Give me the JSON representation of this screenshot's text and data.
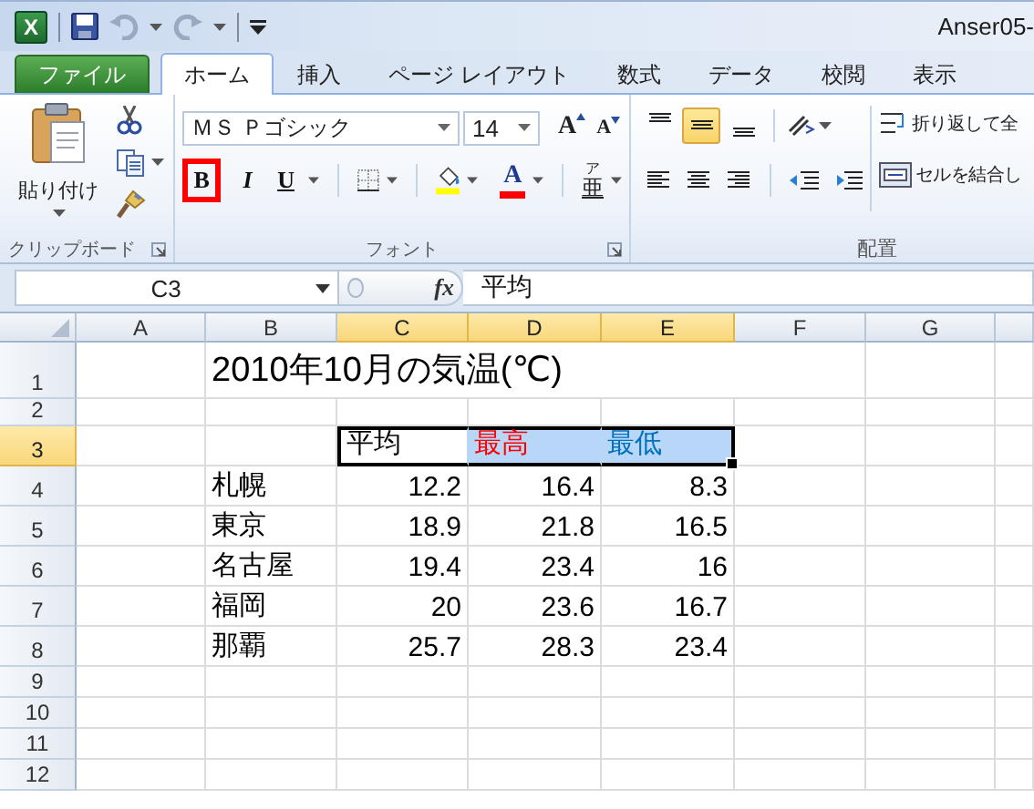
{
  "window": {
    "logo": "X",
    "title": "Anser05-"
  },
  "tabs": [
    {
      "label": "ファイル",
      "kind": "file",
      "selected": false
    },
    {
      "label": "ホーム",
      "kind": "normal",
      "selected": true
    },
    {
      "label": "挿入",
      "kind": "normal",
      "selected": false
    },
    {
      "label": "ページ レイアウト",
      "kind": "normal",
      "selected": false
    },
    {
      "label": "数式",
      "kind": "normal",
      "selected": false
    },
    {
      "label": "データ",
      "kind": "normal",
      "selected": false
    },
    {
      "label": "校閲",
      "kind": "normal",
      "selected": false
    },
    {
      "label": "表示",
      "kind": "normal",
      "selected": false
    }
  ],
  "clipboard": {
    "paste": "貼り付け",
    "label": "クリップボード"
  },
  "font": {
    "font_name": "ＭＳ Ｐゴシック",
    "font_size": "14",
    "grow": "A",
    "shrink": "A",
    "bold": {
      "label": "B",
      "highlighted": true
    },
    "italic": "I",
    "underline": "U",
    "font_color": "A",
    "phonetic": {
      "ruby": "ア",
      "base": "亜"
    },
    "label": "フォント"
  },
  "alignment": {
    "vertical": [
      {
        "kind": "top",
        "selected": false
      },
      {
        "kind": "middle",
        "selected": true
      },
      {
        "kind": "bottom",
        "selected": false
      }
    ],
    "wrap_text": "折り返して全",
    "merge": "セルを結合し",
    "label": "配置"
  },
  "formula_bar": {
    "name_box": "C3",
    "function_button": "fx",
    "formula": "平均"
  },
  "columns": [
    {
      "label": "A",
      "selected": false
    },
    {
      "label": "B",
      "selected": false
    },
    {
      "label": "C",
      "selected": true
    },
    {
      "label": "D",
      "selected": true
    },
    {
      "label": "E",
      "selected": true
    },
    {
      "label": "F",
      "selected": false
    },
    {
      "label": "G",
      "selected": false
    }
  ],
  "rows": [
    {
      "number": "1",
      "selected": false,
      "kind": "title",
      "b": {
        "text": "2010年10月の気温(℃)"
      }
    },
    {
      "number": "2",
      "selected": false
    },
    {
      "number": "3",
      "selected": true,
      "kind": "header",
      "c": {
        "text": "平均",
        "selected": true,
        "active": true
      },
      "d": {
        "text": "最高",
        "color": "#ff0000",
        "selected": true,
        "active": false
      },
      "e": {
        "text": "最低",
        "color": "#0070c0",
        "selected": true,
        "active": false
      }
    },
    {
      "number": "4",
      "selected": false,
      "kind": "data",
      "b": {
        "text": "札幌"
      },
      "c": {
        "text": "12.2"
      },
      "d": {
        "text": "16.4"
      },
      "e": {
        "text": "8.3"
      }
    },
    {
      "number": "5",
      "selected": false,
      "kind": "data",
      "b": {
        "text": "東京"
      },
      "c": {
        "text": "18.9"
      },
      "d": {
        "text": "21.8"
      },
      "e": {
        "text": "16.5"
      }
    },
    {
      "number": "6",
      "selected": false,
      "kind": "data",
      "b": {
        "text": "名古屋"
      },
      "c": {
        "text": "19.4"
      },
      "d": {
        "text": "23.4"
      },
      "e": {
        "text": "16"
      }
    },
    {
      "number": "7",
      "selected": false,
      "kind": "data",
      "b": {
        "text": "福岡"
      },
      "c": {
        "text": "20"
      },
      "d": {
        "text": "23.6"
      },
      "e": {
        "text": "16.7"
      }
    },
    {
      "number": "8",
      "selected": false,
      "kind": "data",
      "b": {
        "text": "那覇"
      },
      "c": {
        "text": "25.7"
      },
      "d": {
        "text": "28.3"
      },
      "e": {
        "text": "23.4"
      }
    },
    {
      "number": "9",
      "selected": false
    },
    {
      "number": "10",
      "selected": false
    },
    {
      "number": "11",
      "selected": false
    },
    {
      "number": "12",
      "selected": false
    }
  ]
}
